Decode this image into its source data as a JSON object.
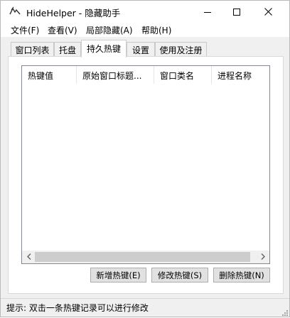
{
  "window": {
    "app_name": "HideHelper - 隐藏助手",
    "icon": "app-logo-icon",
    "controls": {
      "minimize": "minimize-icon",
      "maximize": "maximize-icon",
      "close": "close-icon"
    }
  },
  "menu": {
    "items": [
      {
        "label": "文件(F)"
      },
      {
        "label": "查看(V)"
      },
      {
        "label": "局部隐藏(A)"
      },
      {
        "label": "帮助(H)"
      }
    ]
  },
  "tabs": [
    {
      "label": "窗口列表",
      "active": false
    },
    {
      "label": "托盘",
      "active": false
    },
    {
      "label": "持久热键",
      "active": true
    },
    {
      "label": "设置",
      "active": false
    },
    {
      "label": "使用及注册",
      "active": false
    }
  ],
  "hotkey_list": {
    "columns": [
      {
        "label": "热键值"
      },
      {
        "label": "原始窗口标题..."
      },
      {
        "label": "窗口类名"
      },
      {
        "label": "进程名称"
      }
    ],
    "rows": [],
    "scroll_left_icon": "chevron-left-icon",
    "scroll_right_icon": "chevron-right-icon"
  },
  "buttons": {
    "add": "新增热键(E)",
    "edit": "修改热键(S)",
    "delete": "删除热键(N)"
  },
  "status": {
    "text": "提示: 双击一条热键记录可以进行修改"
  },
  "colors": {
    "titlebar_bg": "#ffffff",
    "window_bg": "#f0f0f0",
    "button_bg": "#e1e1e1",
    "button_border": "#adadad",
    "scroll_thumb": "#cdcdcd"
  }
}
